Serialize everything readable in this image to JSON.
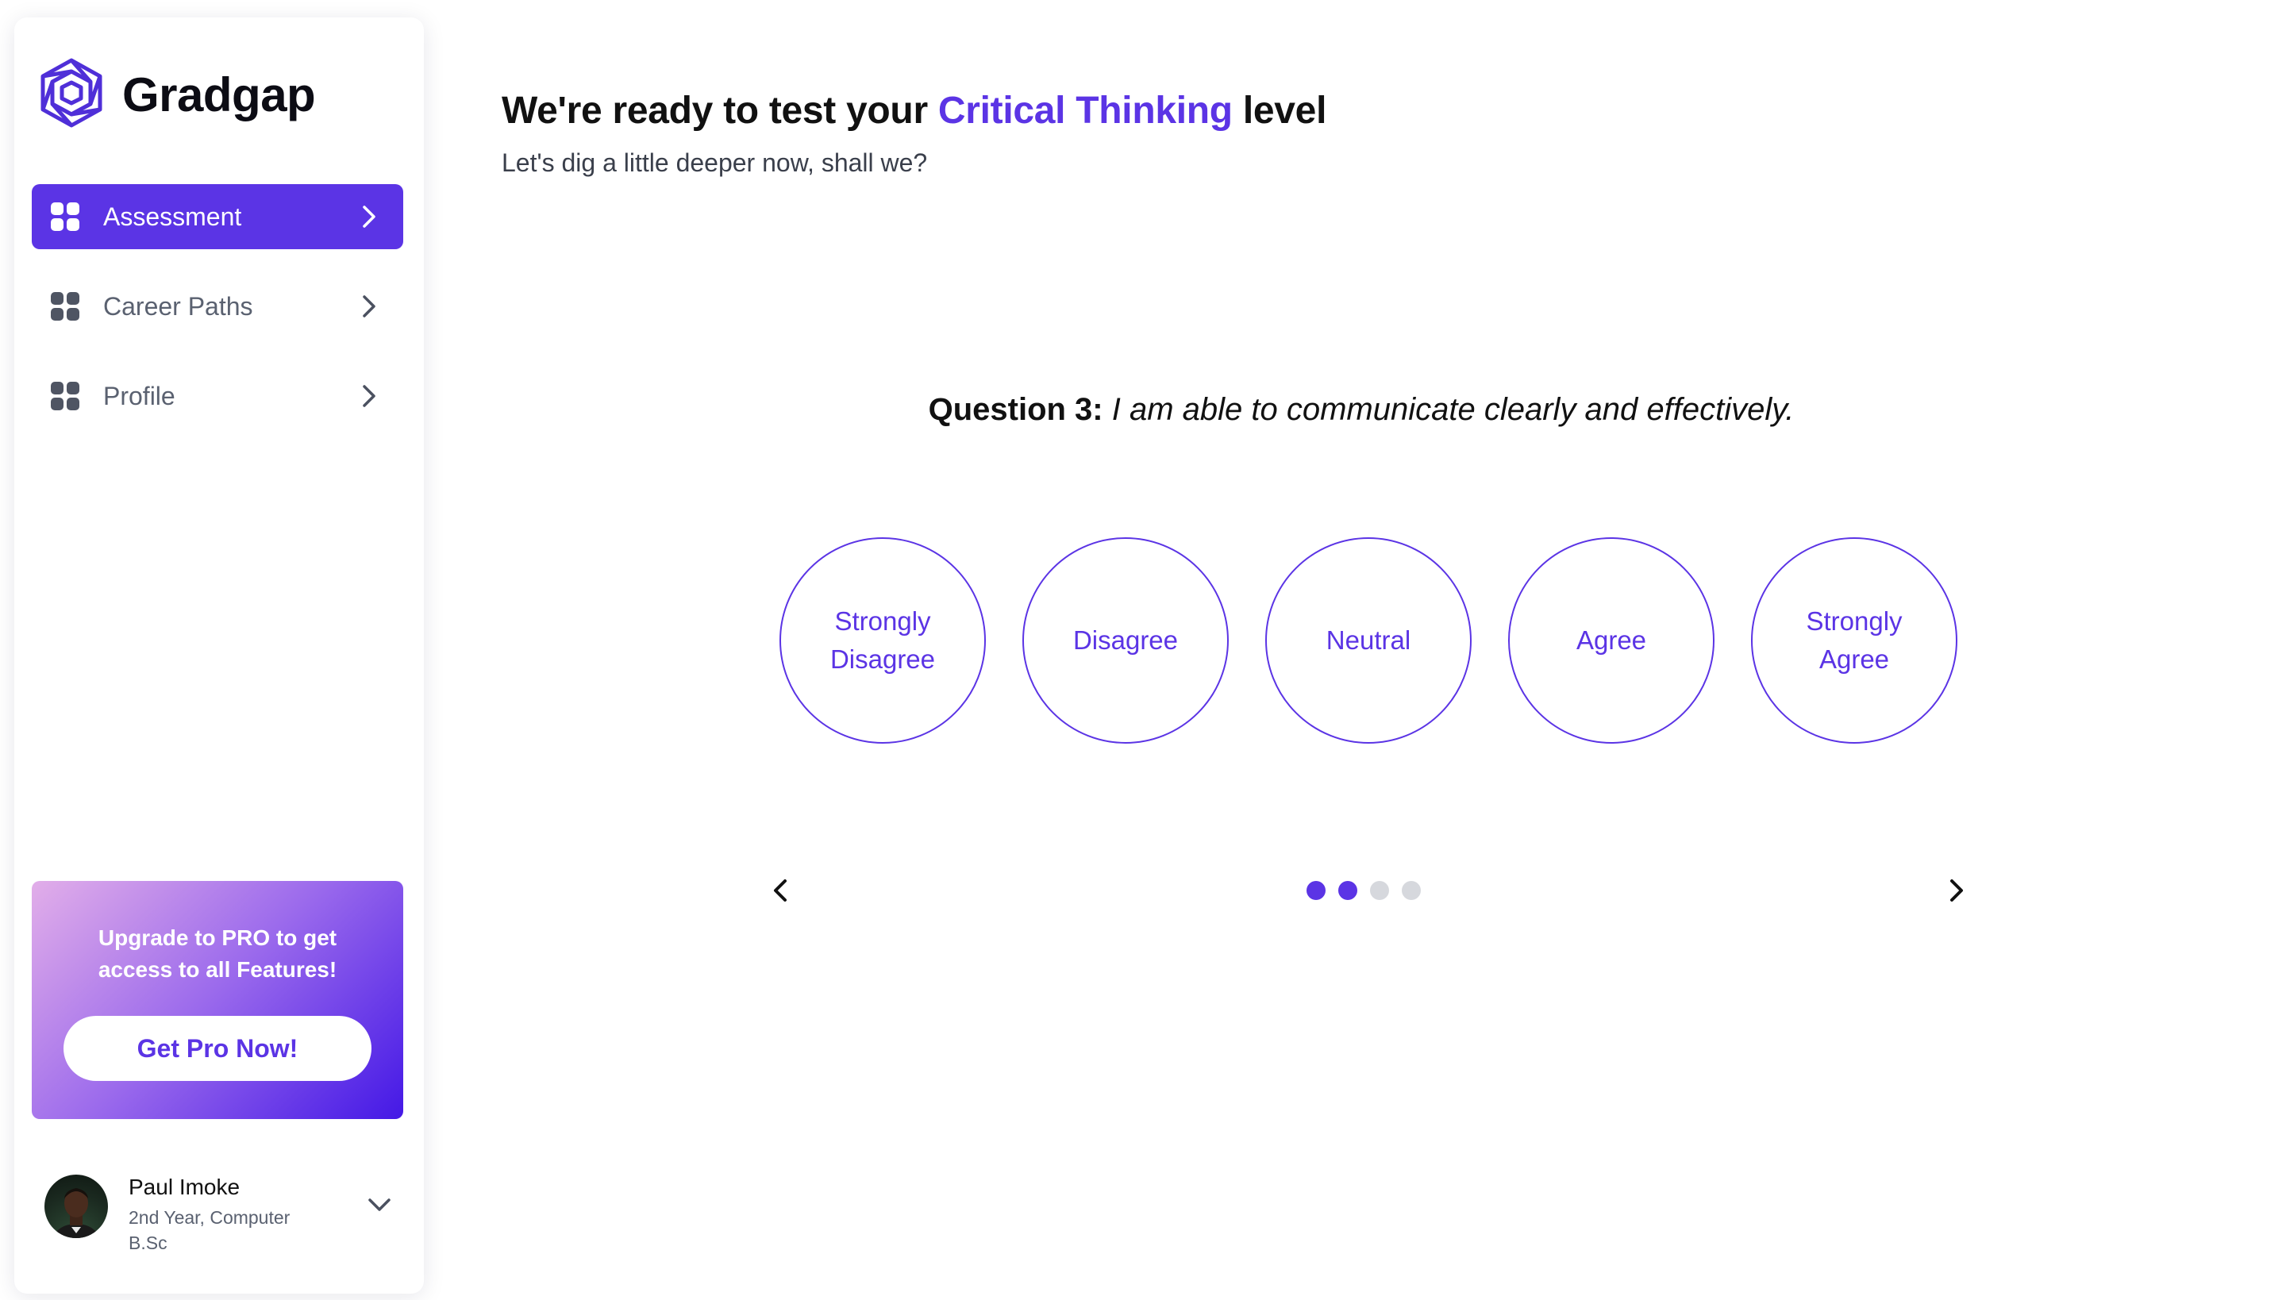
{
  "brand": {
    "name": "Gradgap",
    "logo_icon": "hexagon-logo-icon",
    "accent_color": "#5b34e5"
  },
  "sidebar": {
    "items": [
      {
        "label": "Assessment",
        "icon": "grid-icon",
        "active": true
      },
      {
        "label": "Career Paths",
        "icon": "grid-icon",
        "active": false
      },
      {
        "label": "Profile",
        "icon": "grid-icon",
        "active": false
      }
    ],
    "promo": {
      "text": "Upgrade to PRO to get access to all Features!",
      "button": "Get Pro Now!"
    },
    "user": {
      "name": "Paul Imoke",
      "detail_line1": "2nd Year, Computer",
      "detail_line2": "B.Sc"
    }
  },
  "main": {
    "title_prefix": "We're ready to test your ",
    "title_accent": "Critical Thinking",
    "title_suffix": " level",
    "subtitle": "Let's dig a little deeper now, shall we?",
    "question_label": "Question 3:",
    "question_text": "I am able to communicate clearly and effectively.",
    "options": [
      "Strongly Disagree",
      "Disagree",
      "Neutral",
      "Agree",
      "Strongly Agree"
    ],
    "pagination": {
      "total": 4,
      "completed": 2
    }
  }
}
